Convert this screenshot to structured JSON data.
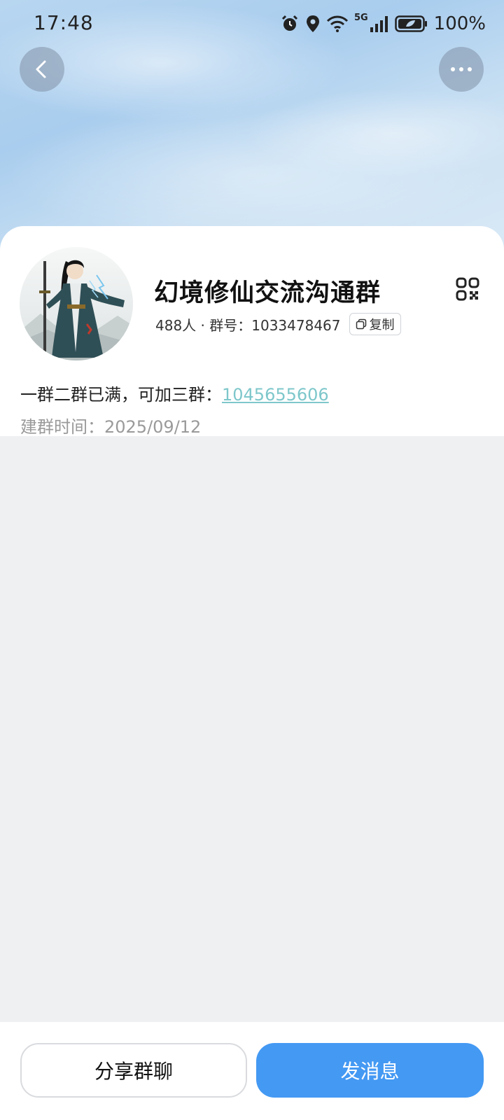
{
  "status_bar": {
    "time": "17:48",
    "network": "5G",
    "battery_percent": "100%",
    "icons": [
      "alarm-icon",
      "location-icon",
      "wifi-icon",
      "signal-icon",
      "battery-icon"
    ]
  },
  "nav": {
    "back_icon": "chevron-left-icon",
    "more_icon": "more-dots-icon"
  },
  "group": {
    "name": "幻境修仙交流沟通群",
    "meta": "488人 · 群号：1033478467",
    "copy_label": "复制",
    "description_prefix": "一群二群已满，可加三群：",
    "description_link": "1045655606",
    "created_label": "建群时间：",
    "created_value": "2025/09/12"
  },
  "actions": {
    "share_label": "分享群聊",
    "send_label": "发消息"
  },
  "colors": {
    "primary": "#4499f3",
    "link": "#7ec7cb"
  }
}
